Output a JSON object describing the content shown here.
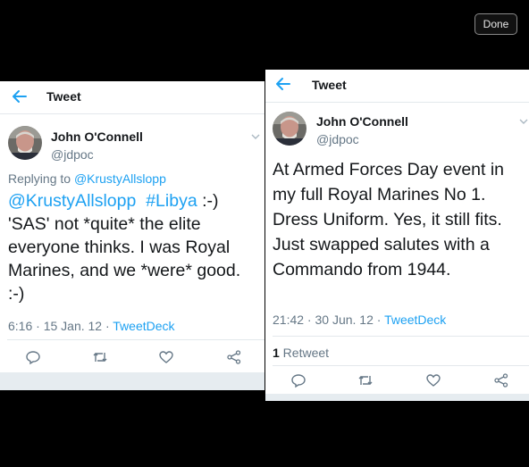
{
  "viewer": {
    "done_label": "Done"
  },
  "tweets": [
    {
      "header_title": "Tweet",
      "author": {
        "name": "John O'Connell",
        "handle": "@jdpoc"
      },
      "replying_prefix": "Replying to",
      "replying_to": "@KrustyAllslopp",
      "body_mention": "@KrustyAllslopp",
      "body_hashtag": "#Libya",
      "body_text": " :-) 'SAS' not *quite* the elite everyone thinks. I was Royal Marines, and we *were* good. :-)",
      "time": "6:16 · 15 Jan. 12 · ",
      "source": "TweetDeck"
    },
    {
      "header_title": "Tweet",
      "author": {
        "name": "John O'Connell",
        "handle": "@jdpoc"
      },
      "body_text": "At Armed Forces Day event in my full Royal Marines No 1. Dress Uniform. Yes, it still fits. Just swapped salutes with a Commando from 1944.",
      "time": "21:42 · 30 Jun. 12 · ",
      "source": "TweetDeck",
      "retweet_count": "1",
      "retweet_label": " Retweet"
    }
  ],
  "icons": [
    "back-arrow-icon",
    "chevron-down-icon",
    "reply-icon",
    "retweet-icon",
    "like-icon",
    "share-icon"
  ],
  "colors": {
    "accent": "#1da1f2",
    "text": "#14171a",
    "secondary": "#657786",
    "icon": "#657786"
  }
}
